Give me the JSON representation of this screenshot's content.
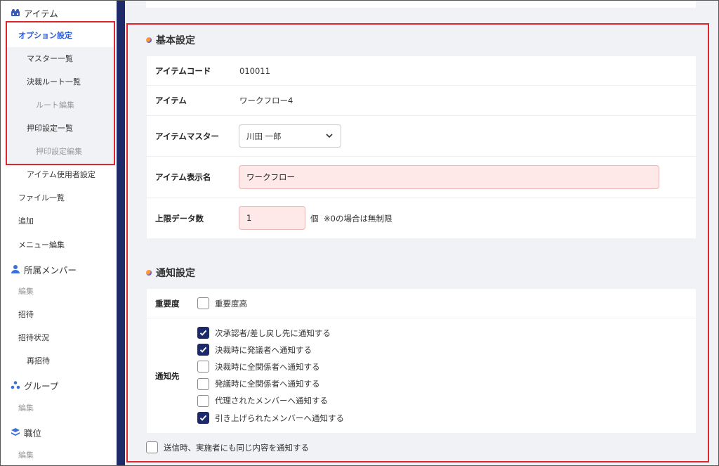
{
  "sidebar": {
    "section_item": "アイテム",
    "option_settings": "オプション設定",
    "master_list": "マスター一覧",
    "approval_route_list": "決裁ルート一覧",
    "route_edit": "ルート編集",
    "seal_list": "押印設定一覧",
    "seal_edit": "押印設定編集",
    "item_user_settings": "アイテム使用者設定",
    "file_list": "ファイル一覧",
    "add": "追加",
    "menu_edit": "メニュー編集",
    "section_members": "所属メンバー",
    "members_edit": "編集",
    "invite": "招待",
    "invite_status": "招待状況",
    "reinvite": "再招待",
    "section_group": "グループ",
    "group_edit": "編集",
    "section_position": "職位",
    "position_edit": "編集"
  },
  "basic": {
    "title": "基本設定",
    "item_code_label": "アイテムコード",
    "item_code_value": "010011",
    "item_label": "アイテム",
    "item_value": "ワークフロー4",
    "item_master_label": "アイテムマスター",
    "item_master_value": "川田 一郎",
    "display_name_label": "アイテム表示名",
    "display_name_value": "ワークフロー",
    "limit_label": "上限データ数",
    "limit_value": "1",
    "limit_unit": "個",
    "limit_note": "※0の場合は無制限"
  },
  "notify": {
    "title": "通知設定",
    "importance_label": "重要度",
    "importance_option": "重要度高",
    "targets_label": "通知先",
    "targets": [
      {
        "label": "次承認者/差し戻し先に通知する",
        "checked": true
      },
      {
        "label": "決裁時に発議者へ通知する",
        "checked": true
      },
      {
        "label": "決裁時に全関係者へ通知する",
        "checked": false
      },
      {
        "label": "発議時に全関係者へ通知する",
        "checked": false
      },
      {
        "label": "代理されたメンバーへ通知する",
        "checked": false
      },
      {
        "label": "引き上げられたメンバーへ通知する",
        "checked": true
      }
    ],
    "send_same_label": "送信時、実施者にも同じ内容を通知する"
  },
  "colors": {
    "accent_blue": "#2b5fd9",
    "navy": "#1c2a6b",
    "highlight_red": "#e0242c",
    "pink_input": "#ffe8e8"
  }
}
